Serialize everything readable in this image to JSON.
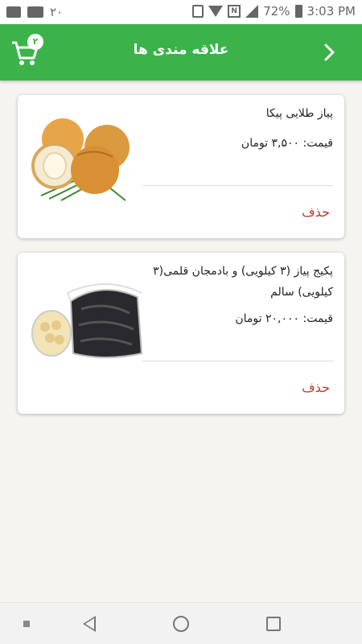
{
  "status_bar": {
    "notification_count": "۲۰",
    "battery": "72%",
    "time": "3:03 PM"
  },
  "app_bar": {
    "title": "علاقه مندی ها",
    "back_icon": "chevron-right-icon",
    "cart_icon": "cart-icon",
    "cart_count": "۲"
  },
  "favorites": [
    {
      "name": "پیاز طلایی پیکا",
      "price": "قیمت: ۳,۵۰۰ تومان",
      "delete_label": "حذف"
    },
    {
      "name": "پکیج پیاز (۳ کیلویی) و بادمجان قلمی(۳ کیلویی) سالم",
      "price": "قیمت: ۲۰,۰۰۰ تومان",
      "delete_label": "حذف"
    }
  ],
  "colors": {
    "primary": "#3bb34a",
    "delete": "#c0392b",
    "background": "#f5f4f0"
  }
}
